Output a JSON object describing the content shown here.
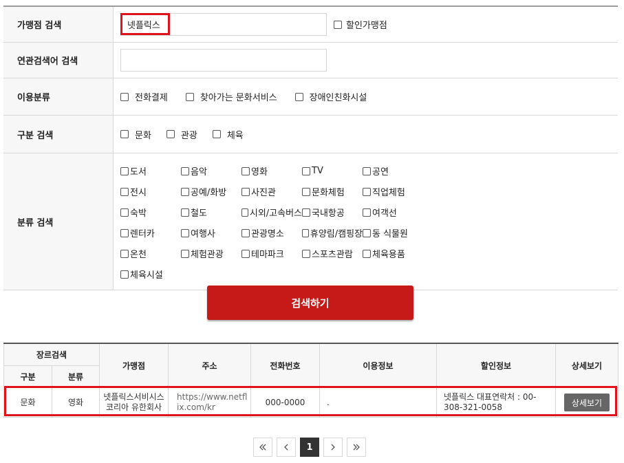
{
  "form": {
    "merchant_search": {
      "label": "가맹점 검색",
      "value": "넷플릭스",
      "discount_label": "할인가맹점"
    },
    "related_search": {
      "label": "연관검색어 검색",
      "value": ""
    },
    "usage": {
      "label": "이용분류",
      "options": [
        "전화결제",
        "찾아가는 문화서비스",
        "장애인친화시설"
      ]
    },
    "division": {
      "label": "구분 검색",
      "options": [
        "문화",
        "관광",
        "체육"
      ]
    },
    "category": {
      "label": "분류 검색",
      "options": [
        "도서",
        "음악",
        "영화",
        "TV",
        "공연",
        "전시",
        "공예/화방",
        "사진관",
        "문화체험",
        "직업체험",
        "숙박",
        "철도",
        "시외/고속버스",
        "국내항공",
        "여객선",
        "렌터카",
        "여행사",
        "관광명소",
        "휴양림/캠핑장",
        "동 식물원",
        "온천",
        "체험관광",
        "테마파크",
        "스포츠관람",
        "체육용품",
        "체육시설"
      ]
    }
  },
  "search_button": "검색하기",
  "table": {
    "headers": {
      "genre": "장르검색",
      "division": "구분",
      "category": "분류",
      "merchant": "가맹점",
      "address": "주소",
      "phone": "전화번호",
      "usage": "이용정보",
      "discount": "할인정보",
      "detail": "상세보기"
    },
    "rows": [
      {
        "division": "문화",
        "category": "영화",
        "merchant": "넷플릭스서비시스코리아 유한회사",
        "address": "https://www.netflix.com/kr",
        "phone": "000-0000",
        "usage": ".",
        "discount": "넷플릭스 대표연락처 : 00-308-321-0058",
        "detail_button": "상세보기"
      }
    ]
  },
  "pagination": {
    "first": "«",
    "prev": "‹",
    "current": "1",
    "next": "›",
    "last": "»"
  },
  "colors": {
    "accent": "#c51a17",
    "highlight": "#e0121b",
    "button_gray": "#666666"
  }
}
